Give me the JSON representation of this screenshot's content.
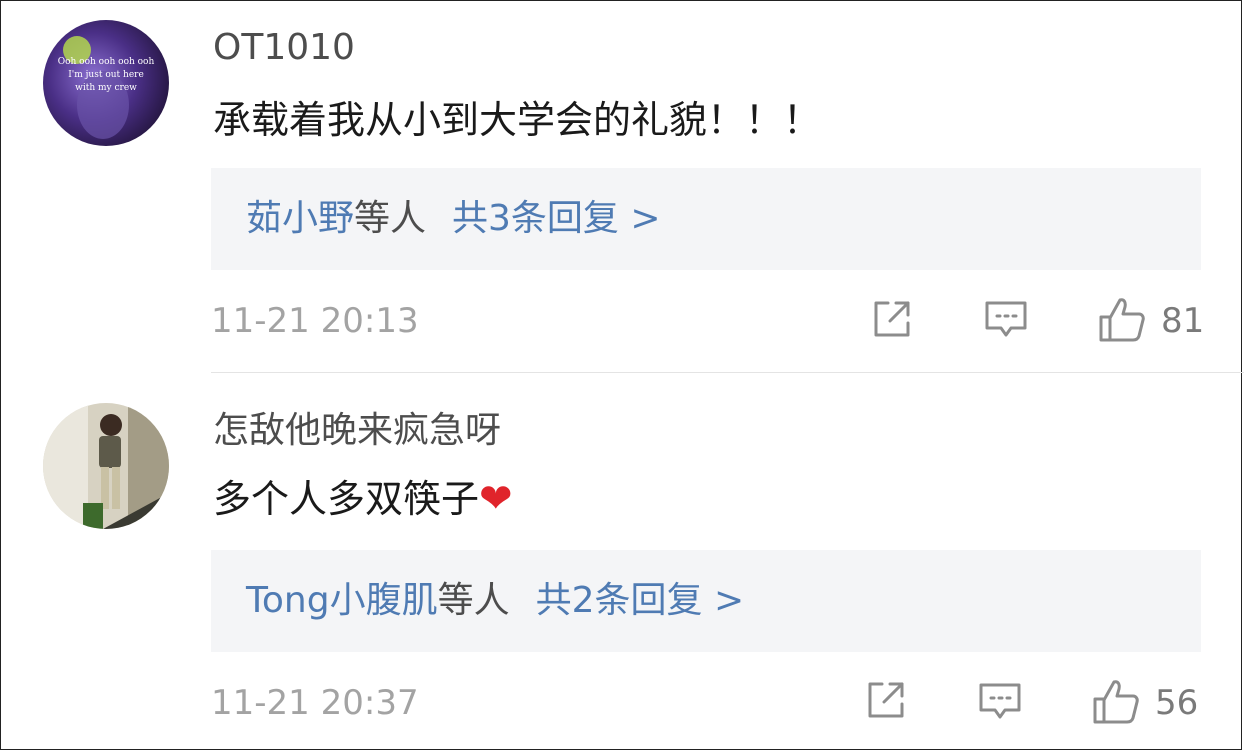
{
  "comments": [
    {
      "username": "OT1010",
      "avatar_caption": [
        "Ooh ooh ooh ooh ooh",
        "I'm just out here",
        "with my crew"
      ],
      "text": "承载着我从小到大学会的礼貌！！！",
      "emoji": "",
      "reply_preview": {
        "names": "茹小野",
        "suffix": "等人",
        "count_text": "共3条回复 >"
      },
      "timestamp": "11-21 20:13",
      "likes": "81"
    },
    {
      "username": "怎敌他晚来疯急呀",
      "text": "多个人多双筷子",
      "emoji": "❤",
      "reply_preview": {
        "names": "Tong小腹肌",
        "suffix": "等人",
        "count_text": "共2条回复 >"
      },
      "timestamp": "11-21 20:37",
      "likes": "56"
    }
  ],
  "icons": {
    "share": "share-icon",
    "comment": "comment-icon",
    "like": "thumbs-up-icon"
  },
  "colors": {
    "link_blue": "#4f7bb3",
    "reply_bg": "#f4f5f7",
    "meta_gray": "#a3a3a3",
    "heart_red": "#e0242b"
  }
}
